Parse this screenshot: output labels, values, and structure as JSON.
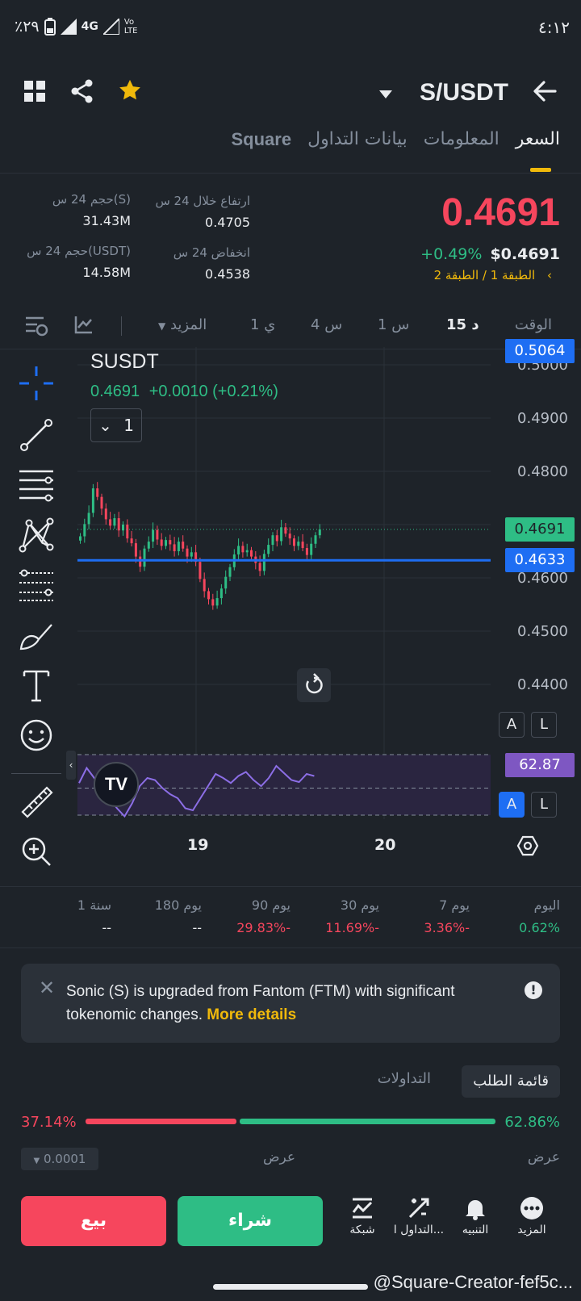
{
  "status_bar": {
    "battery": "٪٢٩",
    "network": "4G",
    "volte": "Vo LTE",
    "time": "٤:١٢"
  },
  "header": {
    "pair": "S/USDT"
  },
  "tabs": [
    {
      "label": "السعر",
      "active": true
    },
    {
      "label": "المعلومات",
      "active": false
    },
    {
      "label": "بيانات التداول",
      "active": false
    },
    {
      "label": "Square",
      "active": false
    }
  ],
  "price": {
    "last": "0.4691",
    "usd": "$0.4691",
    "change": "+0.49%",
    "tier": "الطبقة 1 / الطبقة 2",
    "high_label": "ارتفاع خلال 24 س",
    "high_value": "0.4705",
    "low_label": "انخفاض 24 س",
    "low_value": "0.4538",
    "vol_s_label": "حجم 24 س(S)",
    "vol_s_value": "31.43M",
    "vol_usdt_label": "حجم 24 س(USDT)",
    "vol_usdt_value": "14.58M"
  },
  "intervals": {
    "time_label": "الوقت",
    "items": [
      "15 د",
      "1 س",
      "4 س",
      "1 ي"
    ],
    "active": "15 د",
    "more": "المزيد"
  },
  "chart": {
    "symbol": "SUSDT",
    "legend_price": "0.4691",
    "legend_change": "+0.0010 (+0.21%)",
    "collapse_count": "1",
    "axis": [
      "0.5000",
      "0.4900",
      "0.4800",
      "0.4600",
      "0.4500",
      "0.4400"
    ],
    "tag_top": "0.5064",
    "tag_current": "0.4691",
    "tag_line": "0.4633",
    "rsi_value": "62.87",
    "a_label": "A",
    "l_label": "L",
    "x_labels": [
      "19",
      "20"
    ]
  },
  "chart_data": {
    "type": "candlestick",
    "title": "SUSDT",
    "x_ticks": [
      "19",
      "20"
    ],
    "ylim": [
      0.435,
      0.505
    ],
    "horizontal_line": 0.4633,
    "last_price": 0.4691,
    "indicator": {
      "name": "RSI",
      "value": 62.87
    },
    "closes": [
      0.4678,
      0.4701,
      0.4722,
      0.4768,
      0.4752,
      0.473,
      0.471,
      0.4698,
      0.4712,
      0.4689,
      0.47,
      0.4674,
      0.4665,
      0.464,
      0.4621,
      0.4655,
      0.4668,
      0.469,
      0.4672,
      0.466,
      0.4671,
      0.4663,
      0.465,
      0.4668,
      0.4655,
      0.464,
      0.4648,
      0.463,
      0.4598,
      0.4575,
      0.456,
      0.4548,
      0.4562,
      0.458,
      0.4602,
      0.462,
      0.4644,
      0.466,
      0.4648,
      0.4652,
      0.464,
      0.4628,
      0.4613,
      0.4645,
      0.4662,
      0.468,
      0.4669,
      0.4695,
      0.4683,
      0.4674,
      0.466,
      0.4668,
      0.4656,
      0.4643,
      0.4664,
      0.468,
      0.4691
    ],
    "rsi": [
      55,
      70,
      60,
      48,
      40,
      30,
      22,
      35,
      52,
      60,
      58,
      50,
      44,
      40,
      30,
      28,
      40,
      52,
      64,
      60,
      55,
      62,
      66,
      58,
      52,
      60,
      72,
      65,
      58,
      56,
      64,
      62
    ]
  },
  "performance": [
    {
      "label": "اليوم",
      "value": "0.62%",
      "color": "green"
    },
    {
      "label": "7 يوم",
      "value": "3.36%-",
      "color": "red"
    },
    {
      "label": "30 يوم",
      "value": "11.69%-",
      "color": "red"
    },
    {
      "label": "90 يوم",
      "value": "29.83%-",
      "color": "red"
    },
    {
      "label": "180 يوم",
      "value": "--",
      "color": "white"
    },
    {
      "label": "1 سنة",
      "value": "--",
      "color": "white"
    }
  ],
  "notice": {
    "text": "Sonic (S) is upgraded from Fantom (FTM) with significant tokenomic changes. ",
    "link": "More details"
  },
  "order_book": {
    "tab_active": "قائمة الطلب",
    "tab_other": "التداولات",
    "buy_pct": "62.86%",
    "sell_pct": "37.14%",
    "buy_ratio": 0.6286,
    "bid_label": "عرض",
    "ask_label": "عرض",
    "precision": "0.0001"
  },
  "bottom_bar": {
    "sell": "بيع",
    "buy": "شراء",
    "nav": [
      "المزيد",
      "التنبيه",
      "التداول ا...",
      "شبكة"
    ]
  },
  "watermark": "@Square-Creator-fef5c..."
}
